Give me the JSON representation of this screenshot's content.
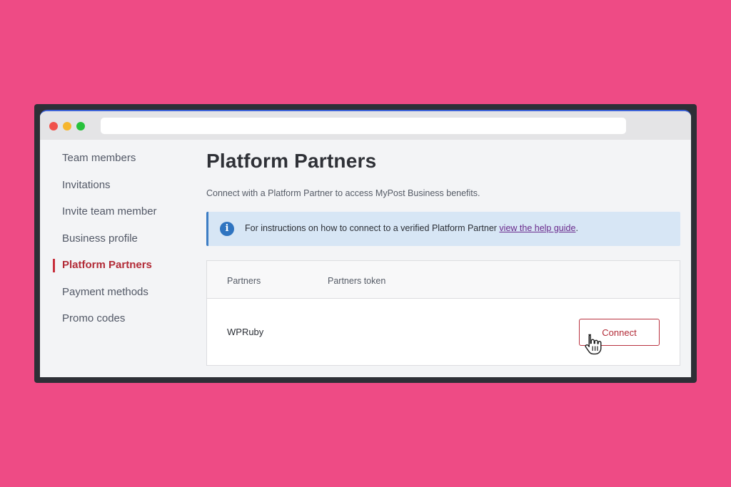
{
  "sidebar": {
    "items": [
      {
        "label": "Team members"
      },
      {
        "label": "Invitations"
      },
      {
        "label": "Invite team member"
      },
      {
        "label": "Business profile"
      },
      {
        "label": "Platform Partners",
        "active": true
      },
      {
        "label": "Payment methods"
      },
      {
        "label": "Promo codes"
      }
    ]
  },
  "main": {
    "title": "Platform Partners",
    "subtitle": "Connect with a Platform Partner to access MyPost Business benefits.",
    "info": {
      "icon": "info-icon",
      "text": "For instructions on how to connect to a verified Platform Partner ",
      "link_text": "view the help guide",
      "suffix": "."
    },
    "table": {
      "columns": [
        "Partners",
        "Partners token"
      ],
      "rows": [
        {
          "partner": "WPRuby",
          "token": "",
          "action_label": "Connect"
        }
      ]
    }
  },
  "colors": {
    "background": "#ee4b85",
    "accent_red": "#b22a36",
    "info_bg": "#d7e6f5",
    "info_icon": "#2f74c0",
    "link": "#6a2a8c"
  }
}
